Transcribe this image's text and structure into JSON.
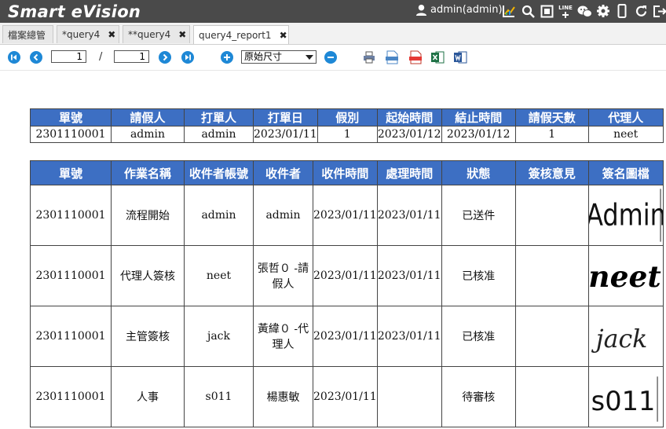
{
  "app": {
    "title": "Smart eVision",
    "user": "admin(admin)"
  },
  "topbar_icons": [
    "user-icon",
    "chart-icon",
    "search-icon",
    "fullscreen-icon",
    "line-icon",
    "wechat-icon",
    "gear-icon",
    "mobile-icon",
    "refresh-icon",
    "logout-icon"
  ],
  "line_label": "LINE",
  "tabs": [
    {
      "label": "檔案總管",
      "closable": false
    },
    {
      "label": "*query4",
      "closable": true
    },
    {
      "label": "**query4",
      "closable": true
    },
    {
      "label": "query4_report1",
      "closable": true,
      "active": true
    }
  ],
  "toolbar": {
    "page_current": "1",
    "page_sep": "/",
    "page_total": "1",
    "zoom": "原始尺寸"
  },
  "summary": {
    "headers": [
      "單號",
      "請假人",
      "打單人",
      "打單日",
      "假別",
      "起始時間",
      "結止時間",
      "請假天數",
      "代理人"
    ],
    "row": [
      "2301110001",
      "admin",
      "admin",
      "2023/01/11",
      "1",
      "2023/01/12",
      "2023/01/12",
      "1",
      "neet"
    ]
  },
  "detail": {
    "headers": [
      "單號",
      "作業名稱",
      "收件者帳號",
      "收件者",
      "收件時間",
      "處理時間",
      "狀態",
      "簽核意見",
      "簽名圖檔"
    ],
    "rows": [
      [
        "2301110001",
        "流程開始",
        "admin",
        "admin",
        "2023/01/11",
        "2023/01/11",
        "已送件",
        "",
        "Admin"
      ],
      [
        "2301110001",
        "代理人簽核",
        "neet",
        "張哲０ -請假人",
        "2023/01/11",
        "2023/01/11",
        "已核准",
        "",
        "neet"
      ],
      [
        "2301110001",
        "主管簽核",
        "jack",
        "黃緯０ -代理人",
        "2023/01/11",
        "2023/01/11",
        "已核准",
        "",
        "jack"
      ],
      [
        "2301110001",
        "人事",
        "s011",
        "楊惠敏",
        "2023/01/11",
        "",
        "待審核",
        "",
        "s011"
      ]
    ]
  },
  "colors": {
    "topbar": "#4a4a4a",
    "header_blue": "#3d6fc3",
    "nav_blue": "#1e88d6"
  }
}
